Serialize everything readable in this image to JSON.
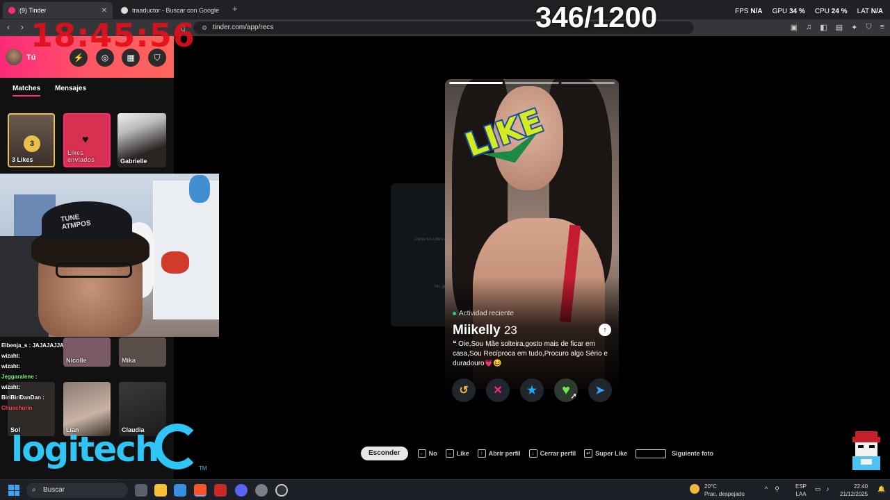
{
  "browser": {
    "tabs": [
      {
        "label": "(9) Tinder",
        "favicon_color": "#fd297b",
        "active": true
      },
      {
        "label": "traaductor - Buscar con Google",
        "favicon_color": "#dddddd",
        "active": false
      }
    ],
    "url": "tinder.com/app/recs"
  },
  "overlay": {
    "clock": "18:45:56",
    "counter": "346/1200",
    "stats": [
      {
        "label": "FPS",
        "value": "N/A"
      },
      {
        "label": "GPU",
        "value": "34 %"
      },
      {
        "label": "CPU",
        "value": "24 %"
      },
      {
        "label": "LAT",
        "value": "N/A"
      }
    ]
  },
  "sidebar": {
    "user": "Tú",
    "tabs": [
      "Matches",
      "Mensajes"
    ],
    "matches": [
      {
        "label": "3 Likes",
        "count": "3"
      },
      {
        "label": "Likes enviados"
      },
      {
        "label": "Gabrielle"
      }
    ],
    "more_matches": [
      "Nicolle",
      "Mika",
      "Sol",
      "Lian",
      "Claudia"
    ]
  },
  "chat": [
    {
      "user": "Elbenja_s",
      "msg": " : JAJAJAJJA"
    },
    {
      "user": "wizaht",
      "msg": ": "
    },
    {
      "user": "wizaht",
      "msg": ": "
    },
    {
      "user": "Jeggaralene",
      "msg": " : "
    },
    {
      "user": "wizaht",
      "msg": ": "
    },
    {
      "user": "BiriBiriDanDan",
      "msg": " : "
    },
    {
      "user": "Chuschurin",
      "msg": ""
    }
  ],
  "brand": {
    "logo": "logitech",
    "tm": "TM",
    "color": "#2fc6f6"
  },
  "card": {
    "stamp": "LIKE",
    "activity": "Actividad reciente",
    "name": "Miikelly",
    "age": "23",
    "bio": "Oie,Sou Mãe solteira,gosto mais de ficar em casa,Sou Recíproca em tudo,Procuro algo Sério e duradouro💗😆",
    "modal_title": "¡Lleva tus Likes al siguiente nivel!",
    "modal_dismiss": "No, gracias"
  },
  "actions": [
    {
      "name": "rewind",
      "icon": "↺",
      "color": "#f5b748"
    },
    {
      "name": "nope",
      "icon": "✕",
      "color": "#fd267a"
    },
    {
      "name": "super-like",
      "icon": "★",
      "color": "#1fa7f2"
    },
    {
      "name": "like",
      "icon": "♥",
      "color": "#72e64a"
    },
    {
      "name": "boost",
      "icon": "➤",
      "color": "#3aa3f0"
    }
  ],
  "shortcuts": {
    "hide": "Esconder",
    "items": [
      {
        "key": "←",
        "label": "No"
      },
      {
        "key": "→",
        "label": "Like"
      },
      {
        "key": "↑",
        "label": "Abrir perfil"
      },
      {
        "key": "↓",
        "label": "Cerrar perfil"
      },
      {
        "key": "↵",
        "label": "Super Like"
      }
    ],
    "space_label": "Siguiente foto"
  },
  "taskbar": {
    "search": "Buscar",
    "weather_temp": "20°C",
    "weather_desc": "Prac. despejado",
    "lang_1": "ESP",
    "lang_2": "LAA",
    "time": "22:40",
    "date": "21/12/2025"
  }
}
